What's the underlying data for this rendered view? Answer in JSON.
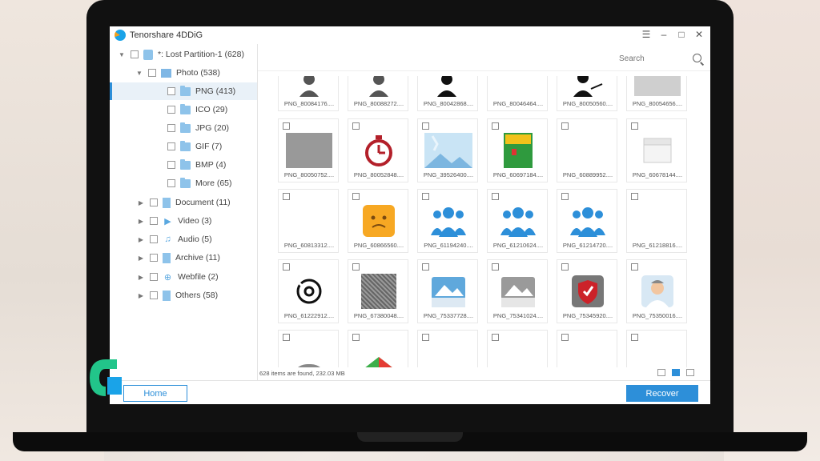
{
  "app": {
    "title": "Tenorshare 4DDiG",
    "window_controls": [
      "menu",
      "minimize",
      "maximize",
      "close"
    ]
  },
  "sidebar": {
    "items": [
      {
        "label": "*: Lost Partition-1  (628)",
        "icon": "drive-icon",
        "expanded": true
      },
      {
        "label": "Photo  (538)",
        "icon": "image-icon",
        "expanded": true
      },
      {
        "label": "PNG  (413)",
        "icon": "folder-icon",
        "selected": true
      },
      {
        "label": "ICO  (29)",
        "icon": "folder-icon"
      },
      {
        "label": "JPG  (20)",
        "icon": "folder-icon"
      },
      {
        "label": "GIF  (7)",
        "icon": "folder-icon"
      },
      {
        "label": "BMP  (4)",
        "icon": "folder-icon"
      },
      {
        "label": "More  (65)",
        "icon": "folder-icon"
      },
      {
        "label": "Document  (11)",
        "icon": "document-icon"
      },
      {
        "label": "Video  (3)",
        "icon": "video-icon"
      },
      {
        "label": "Audio  (5)",
        "icon": "music-icon"
      },
      {
        "label": "Archive  (11)",
        "icon": "archive-icon"
      },
      {
        "label": "Webfile  (2)",
        "icon": "globe-icon"
      },
      {
        "label": "Others  (58)",
        "icon": "file-icon"
      }
    ]
  },
  "search": {
    "placeholder": "Search"
  },
  "grid": {
    "rows": [
      [
        "PNG_80084176....",
        "PNG_80088272....",
        "PNG_80042868....",
        "PNG_80046464....",
        "PNG_80050560....",
        "PNG_80054656...."
      ],
      [
        "PNG_80050752....",
        "PNG_80052848....",
        "PNG_39526400....",
        "PNG_60697184....",
        "PNG_60889952....",
        "PNG_60678144...."
      ],
      [
        "PNG_60813312....",
        "PNG_60866560....",
        "PNG_61194240....",
        "PNG_61210624....",
        "PNG_61214720....",
        "PNG_61218816...."
      ],
      [
        "PNG_61222912....",
        "PNG_67380048....",
        "PNG_75337728....",
        "PNG_75341024....",
        "PNG_75345920....",
        "PNG_75350016...."
      ],
      [
        "",
        "",
        "",
        "",
        "",
        ""
      ]
    ]
  },
  "status": {
    "text": "628 items are found, 232.03 MB"
  },
  "buttons": {
    "home": "Home",
    "recover": "Recover"
  },
  "colors": {
    "accent": "#2d8fd9",
    "selected_row": "#e9f1f8"
  }
}
